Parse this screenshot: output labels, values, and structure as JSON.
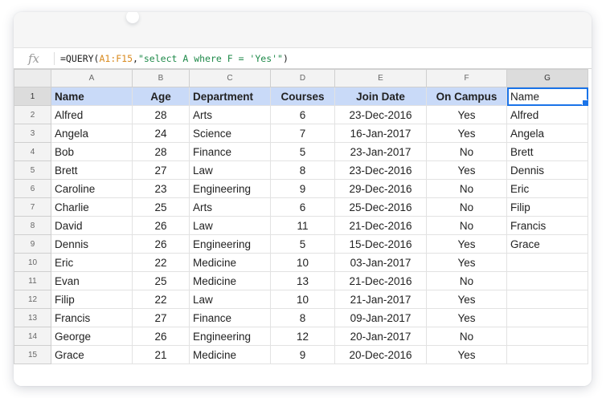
{
  "formula_bar": {
    "icon": "fx",
    "prefix": "=QUERY(",
    "range_ref": "A1:F15",
    "comma": ",",
    "query_string": "\"select A where F = 'Yes'\"",
    "suffix": ")"
  },
  "columns": [
    "A",
    "B",
    "C",
    "D",
    "E",
    "F",
    "G"
  ],
  "headers": [
    "Name",
    "Age",
    "Department",
    "Courses",
    "Join Date",
    "On Campus",
    "Name"
  ],
  "rows": [
    {
      "num": "2",
      "name": "Alfred",
      "age": "28",
      "dept": "Arts",
      "courses": "6",
      "date": "23-Dec-2016",
      "campus": "Yes",
      "g": "Alfred"
    },
    {
      "num": "3",
      "name": "Angela",
      "age": "24",
      "dept": "Science",
      "courses": "7",
      "date": "16-Jan-2017",
      "campus": "Yes",
      "g": "Angela"
    },
    {
      "num": "4",
      "name": "Bob",
      "age": "28",
      "dept": "Finance",
      "courses": "5",
      "date": "23-Jan-2017",
      "campus": "No",
      "g": "Brett"
    },
    {
      "num": "5",
      "name": "Brett",
      "age": "27",
      "dept": "Law",
      "courses": "8",
      "date": "23-Dec-2016",
      "campus": "Yes",
      "g": "Dennis"
    },
    {
      "num": "6",
      "name": "Caroline",
      "age": "23",
      "dept": "Engineering",
      "courses": "9",
      "date": "29-Dec-2016",
      "campus": "No",
      "g": "Eric"
    },
    {
      "num": "7",
      "name": "Charlie",
      "age": "25",
      "dept": "Arts",
      "courses": "6",
      "date": "25-Dec-2016",
      "campus": "No",
      "g": "Filip"
    },
    {
      "num": "8",
      "name": "David",
      "age": "26",
      "dept": "Law",
      "courses": "11",
      "date": "21-Dec-2016",
      "campus": "No",
      "g": "Francis"
    },
    {
      "num": "9",
      "name": "Dennis",
      "age": "26",
      "dept": "Engineering",
      "courses": "5",
      "date": "15-Dec-2016",
      "campus": "Yes",
      "g": "Grace"
    },
    {
      "num": "10",
      "name": "Eric",
      "age": "22",
      "dept": "Medicine",
      "courses": "10",
      "date": "03-Jan-2017",
      "campus": "Yes",
      "g": ""
    },
    {
      "num": "11",
      "name": "Evan",
      "age": "25",
      "dept": "Medicine",
      "courses": "13",
      "date": "21-Dec-2016",
      "campus": "No",
      "g": ""
    },
    {
      "num": "12",
      "name": "Filip",
      "age": "22",
      "dept": "Law",
      "courses": "10",
      "date": "21-Jan-2017",
      "campus": "Yes",
      "g": ""
    },
    {
      "num": "13",
      "name": "Francis",
      "age": "27",
      "dept": "Finance",
      "courses": "8",
      "date": "09-Jan-2017",
      "campus": "Yes",
      "g": ""
    },
    {
      "num": "14",
      "name": "George",
      "age": "26",
      "dept": "Engineering",
      "courses": "12",
      "date": "20-Jan-2017",
      "campus": "No",
      "g": ""
    },
    {
      "num": "15",
      "name": "Grace",
      "age": "21",
      "dept": "Medicine",
      "courses": "9",
      "date": "20-Dec-2016",
      "campus": "Yes",
      "g": ""
    }
  ],
  "header_row_num": "1",
  "colors": {
    "header_fill": "#c9daf8",
    "selection": "#1a73e8",
    "range_ref": "#d98a1e",
    "string_literal": "#1f8a4a"
  }
}
